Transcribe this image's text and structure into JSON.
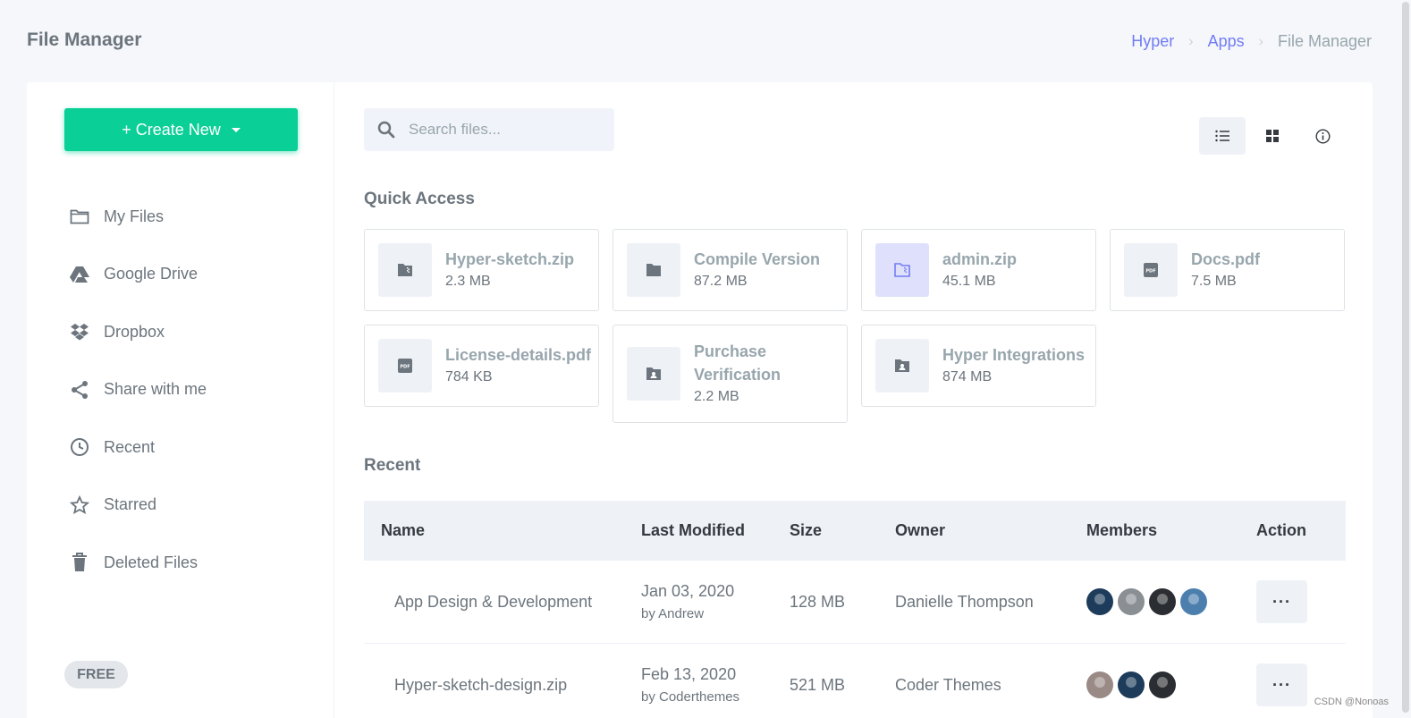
{
  "header": {
    "title": "File Manager",
    "breadcrumb": [
      {
        "label": "Hyper"
      },
      {
        "label": "Apps"
      },
      {
        "label": "File Manager"
      }
    ]
  },
  "sidebar": {
    "create_label": "+ Create New",
    "items": [
      {
        "label": "My Files",
        "icon": "folder-icon"
      },
      {
        "label": "Google Drive",
        "icon": "google-drive-icon"
      },
      {
        "label": "Dropbox",
        "icon": "dropbox-icon"
      },
      {
        "label": "Share with me",
        "icon": "share-icon"
      },
      {
        "label": "Recent",
        "icon": "clock-icon"
      },
      {
        "label": "Starred",
        "icon": "star-icon"
      },
      {
        "label": "Deleted Files",
        "icon": "trash-icon"
      }
    ],
    "plan_badge": "FREE"
  },
  "search": {
    "placeholder": "Search files..."
  },
  "view_toggles": [
    {
      "icon": "list-view-icon",
      "active": true
    },
    {
      "icon": "grid-view-icon",
      "active": false
    },
    {
      "icon": "info-icon",
      "active": false
    }
  ],
  "quick_access": {
    "title": "Quick Access",
    "files": [
      {
        "name": "Hyper-sketch.zip",
        "size": "2.3 MB",
        "icon": "zip-folder-icon"
      },
      {
        "name": "Compile Version",
        "size": "87.2 MB",
        "icon": "folder-icon"
      },
      {
        "name": "admin.zip",
        "size": "45.1 MB",
        "icon": "zip-folder-icon"
      },
      {
        "name": "Docs.pdf",
        "size": "7.5 MB",
        "icon": "pdf-icon"
      },
      {
        "name": "License-details.pdf",
        "size": "784 KB",
        "icon": "pdf-icon"
      },
      {
        "name": "Purchase Verification",
        "size": "2.2 MB",
        "icon": "user-folder-icon"
      },
      {
        "name": "Hyper Integrations",
        "size": "874 MB",
        "icon": "user-folder-icon"
      }
    ]
  },
  "recent": {
    "title": "Recent",
    "columns": [
      "Name",
      "Last Modified",
      "Size",
      "Owner",
      "Members",
      "Action"
    ],
    "rows": [
      {
        "name": "App Design & Development",
        "date": "Jan 03, 2020",
        "by": "by Andrew",
        "size": "128 MB",
        "owner": "Danielle Thompson",
        "members": [
          "#1d3b5a",
          "#8a8f94",
          "#2a2d31",
          "#4c7fae"
        ],
        "action": "···"
      },
      {
        "name": "Hyper-sketch-design.zip",
        "date": "Feb 13, 2020",
        "by": "by Coderthemes",
        "size": "521 MB",
        "owner": "Coder Themes",
        "members": [
          "#9a8a86",
          "#1d3b5a",
          "#2a2d31"
        ],
        "action": "···"
      }
    ]
  },
  "colors": {
    "accent": "#727cf5",
    "success": "#0acf97"
  },
  "watermark": "CSDN @Nonoas"
}
